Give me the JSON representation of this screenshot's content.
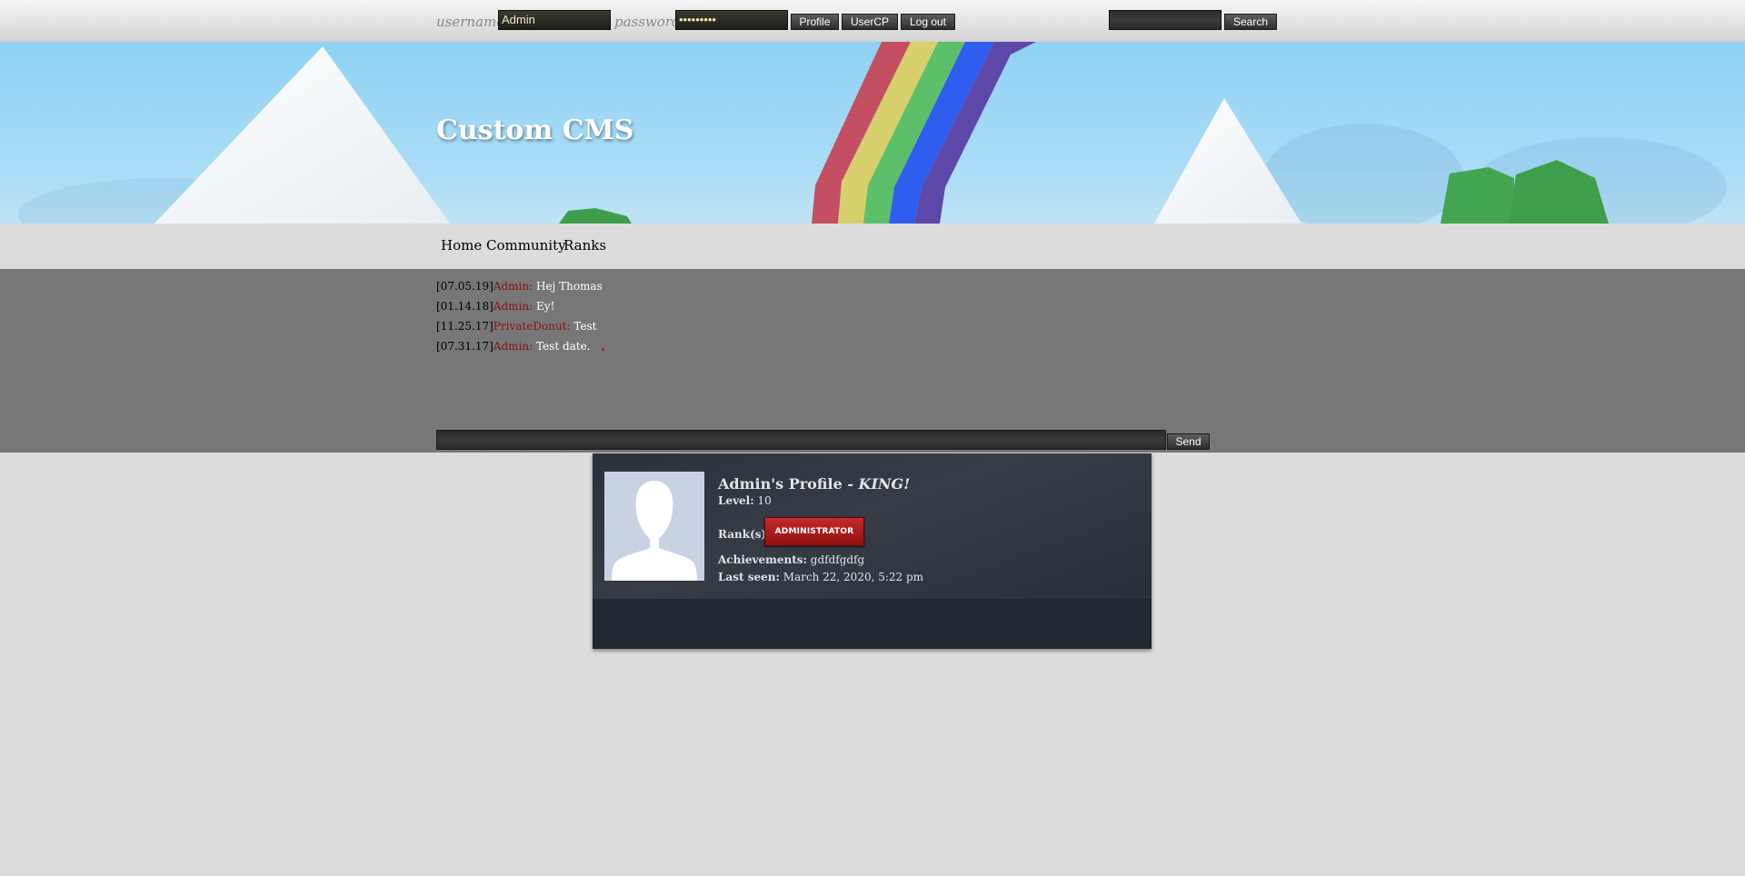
{
  "header": {
    "username_label": "username:",
    "username_value": "Admin",
    "password_label": "password:",
    "password_value": "•••••••••",
    "profile_button": "Profile",
    "usercp_button": "UserCP",
    "logout_button": "Log out",
    "search_value": "",
    "search_button": "Search"
  },
  "banner": {
    "site_title": "Custom CMS"
  },
  "nav": {
    "items": [
      "Home",
      "Community",
      "Ranks"
    ]
  },
  "shoutbox": {
    "messages": [
      {
        "date": "[07.05.19]",
        "user": "Admin:",
        "text": "Hej Thomas"
      },
      {
        "date": "[01.14.18]",
        "user": "Admin:",
        "text": "Ey!"
      },
      {
        "date": "[11.25.17]",
        "user": "PrivateDonut:",
        "text": "Test"
      },
      {
        "date": "[07.31.17]",
        "user": "Admin:",
        "text": "Test date."
      }
    ],
    "input_value": "",
    "send_button": "Send"
  },
  "profile": {
    "title": "Admin's Profile - ",
    "title_tag": "KING!",
    "level_label": "Level:",
    "level_value": "10",
    "ranks_label": "Rank(s):",
    "rank_badge": "ADMINISTRATOR",
    "achievements_label": "Achievements:",
    "achievements_value": "gdfdfgdfg",
    "last_seen_label": "Last seen:",
    "last_seen_value": "March 22, 2020, 5:22 pm"
  },
  "colors": {
    "username_color": "#8b1010",
    "profile_bg": "#272d37",
    "rank_badge": "#b01c1c"
  }
}
